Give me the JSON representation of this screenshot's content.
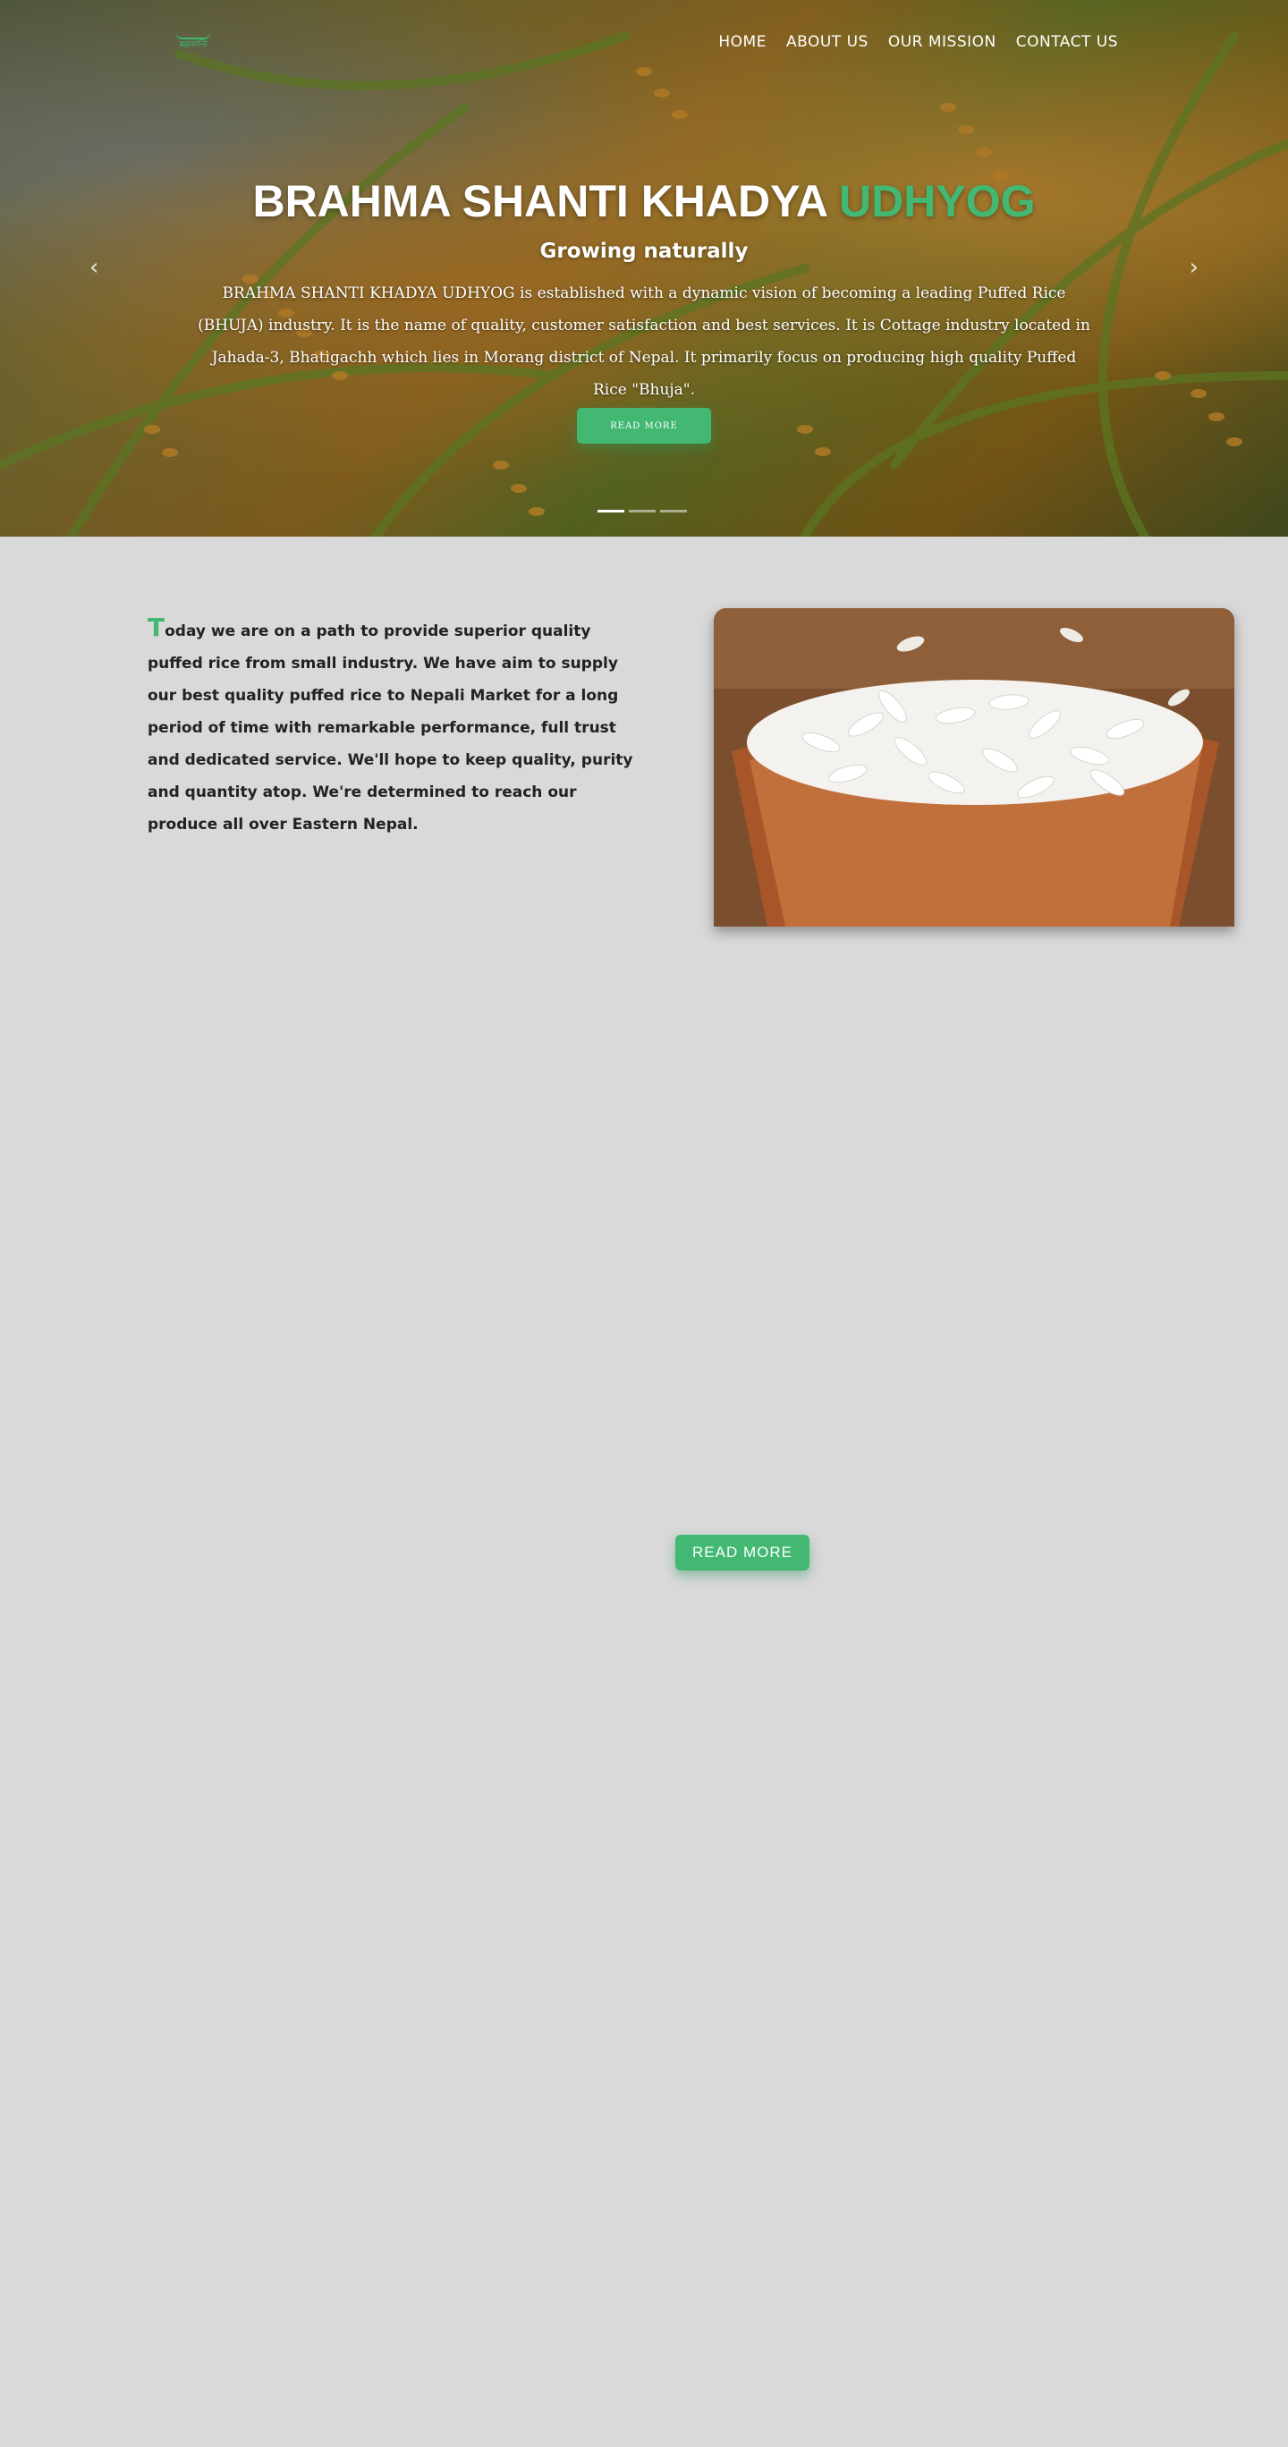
{
  "header": {
    "logo_text": "ब्रह्मशान्ति",
    "nav": [
      "HOME",
      "ABOUT US",
      "OUR MISSION",
      "CONTACT US"
    ]
  },
  "hero": {
    "title_main": "BRAHMA SHANTI KHADYA ",
    "title_accent": "UDHYOG",
    "subtitle": "Growing naturally",
    "description": "BRAHMA SHANTI KHADYA UDHYOG is established with a dynamic vision of becoming a leading Puffed Rice (BHUJA) industry. It is the name of quality, customer satisfaction and best services. It is Cottage industry located in Jahada-3, Bhatigachh which lies in Morang district of Nepal. It primarily focus on producing high quality Puffed Rice \"Bhuja\".",
    "button_label": "READ MORE",
    "prev_icon": "‹",
    "next_icon": "›",
    "slide_count": 3,
    "active_slide": 1
  },
  "about": {
    "dropcap": "T",
    "text": "oday we are on a path to provide superior quality puffed rice from small industry. We have aim to supply our best quality puffed rice to Nepali Market for a long period of time with remarkable performance, full trust and dedicated service. We'll hope to keep quality, purity and quantity atop. We're determined to reach our produce all over Eastern Nepal.",
    "button_label": "READ MORE"
  },
  "colors": {
    "accent": "#42b873",
    "page_background": "#dad9da"
  }
}
